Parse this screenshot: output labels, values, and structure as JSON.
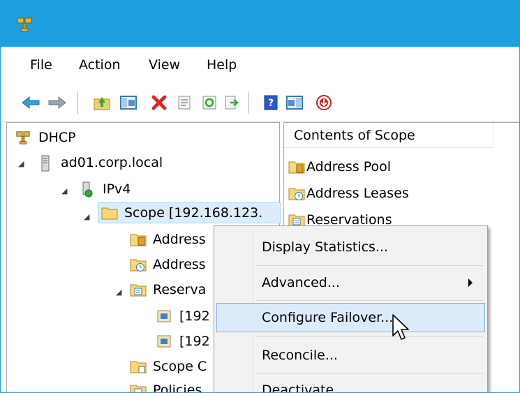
{
  "window": {
    "app_icon": "dhcp-icon",
    "accent_color": "#1ea0e0"
  },
  "menubar": {
    "file": "File",
    "action": "Action",
    "view": "View",
    "help": "Help"
  },
  "toolbar": {
    "icons": [
      "back-arrow-icon",
      "forward-arrow-icon",
      "up-folder-icon",
      "show-hide-tree-icon",
      "delete-icon",
      "properties-icon",
      "refresh-icon",
      "export-list-icon",
      "help-icon",
      "action-pane-icon",
      "deactivate-icon"
    ]
  },
  "tree": {
    "root": "DHCP",
    "server": "ad01.corp.local",
    "ipv4": "IPv4",
    "scope": "Scope [192.168.123.",
    "address_pool": "Address",
    "address_leases": "Address",
    "reservations": "Reserva",
    "reservation_1": "[192",
    "reservation_2": "[192",
    "scope_options": "Scope C",
    "policies": "Policies"
  },
  "content": {
    "column_header": "Contents of Scope",
    "items": [
      "Address Pool",
      "Address Leases",
      "Reservations"
    ]
  },
  "context_menu": {
    "display_statistics": "Display Statistics...",
    "advanced": "Advanced...",
    "configure_failover": "Configure Failover...",
    "reconcile": "Reconcile...",
    "deactivate": "Deactivate"
  }
}
